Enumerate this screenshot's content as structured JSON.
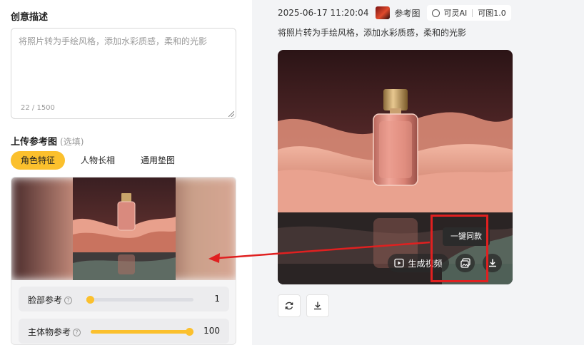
{
  "left": {
    "creative_title": "创意描述",
    "prompt_placeholder": "将照片转为手绘风格，添加水彩质感，柔和的光影",
    "char_count": "22 / 1500",
    "upload_title": "上传参考图",
    "upload_optional": "(选填)",
    "tabs": [
      {
        "label": "角色特征",
        "active": true
      },
      {
        "label": "人物长相",
        "active": false
      },
      {
        "label": "通用垫图",
        "active": false
      }
    ],
    "sliders": [
      {
        "label": "脸部参考",
        "value": "1",
        "fraction": 0.01
      },
      {
        "label": "主体物参考",
        "value": "100",
        "fraction": 1.0
      }
    ]
  },
  "right": {
    "timestamp": "2025-06-17 11:20:04",
    "ref_label": "参考图",
    "model_badge": {
      "brand": "可灵AI",
      "model": "可图1.0"
    },
    "prompt": "将照片转为手绘风格，添加水彩质感，柔和的光影",
    "overlay": {
      "generate_video": "生成视频",
      "tooltip": "一键同款"
    }
  },
  "icons": {
    "play": "play-icon",
    "same_style": "image-stack-icon",
    "download": "download-icon",
    "refresh": "refresh-icon"
  },
  "colors": {
    "accent": "#fbc02d",
    "annotation": "#e02020",
    "panel_bg": "#f3f4f6"
  }
}
